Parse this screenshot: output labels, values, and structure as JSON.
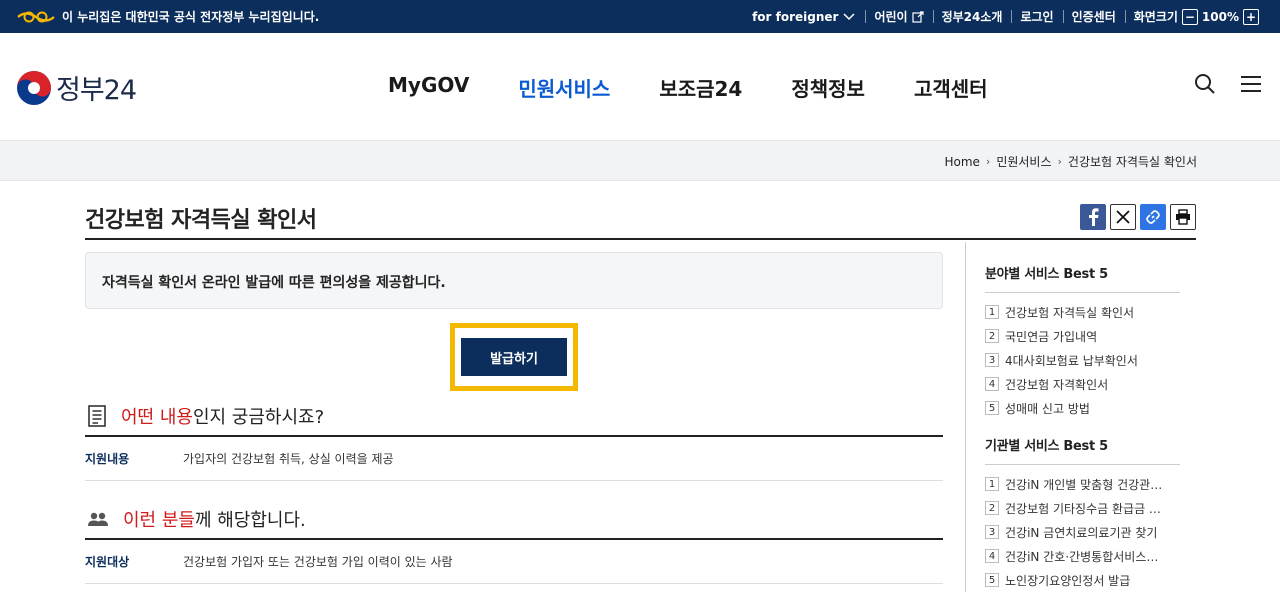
{
  "topbar": {
    "notice": "이 누리집은 대한민국 공식 전자정부 누리집입니다.",
    "links": [
      "for foreigner",
      "어린이",
      "정부24소개",
      "로그인",
      "인증센터",
      "화면크기"
    ],
    "zoom_minus": "−",
    "zoom_value": "100%",
    "zoom_plus": "+"
  },
  "header": {
    "logo_text": "정부24",
    "nav": [
      "MyGOV",
      "민원서비스",
      "보조금24",
      "정책정보",
      "고객센터"
    ],
    "active_nav": "민원서비스"
  },
  "breadcrumb": [
    "Home",
    "민원서비스",
    "건강보험 자격득실 확인서"
  ],
  "page": {
    "title": "건강보험 자격득실 확인서",
    "info": "자격득실 확인서 온라인 발급에 따른 편의성을 제공합니다.",
    "issue_button": "발급하기"
  },
  "section1": {
    "highlight": "어떤 내용",
    "rest": "인지 궁금하시죠?",
    "key": "지원내용",
    "value": "가입자의 건강보험 취득, 상실 이력을 제공"
  },
  "section2": {
    "highlight": "이런 분들",
    "rest": "께 해당합니다.",
    "key": "지원대상",
    "value": "건강보험 가입자 또는 건강보험 가입 이력이 있는 사람"
  },
  "sidebar": {
    "field_title": "분야별 서비스 Best 5",
    "field_items": [
      {
        "num": "1",
        "label": "건강보험 자격득실 확인서"
      },
      {
        "num": "2",
        "label": "국민연금 가입내역"
      },
      {
        "num": "3",
        "label": "4대사회보험료 납부확인서"
      },
      {
        "num": "4",
        "label": "건강보험 자격확인서"
      },
      {
        "num": "5",
        "label": "성매매 신고 방법"
      }
    ],
    "agency_title": "기관별 서비스 Best 5",
    "agency_items": [
      {
        "num": "1",
        "label": "건강iN 개인별 맞춤형 건강관…"
      },
      {
        "num": "2",
        "label": "건강보험 기타징수금 환급금 …"
      },
      {
        "num": "3",
        "label": "건강iN 금연치료의료기관 찾기"
      },
      {
        "num": "4",
        "label": "건강iN 간호·간병통합서비스…"
      },
      {
        "num": "5",
        "label": "노인장기요양인정서 발급"
      }
    ]
  },
  "colors": {
    "navy": "#0b2e5c",
    "accent_blue": "#0a5bd3",
    "highlight_red": "#d11a1a",
    "focus_yellow": "#f5b800"
  }
}
